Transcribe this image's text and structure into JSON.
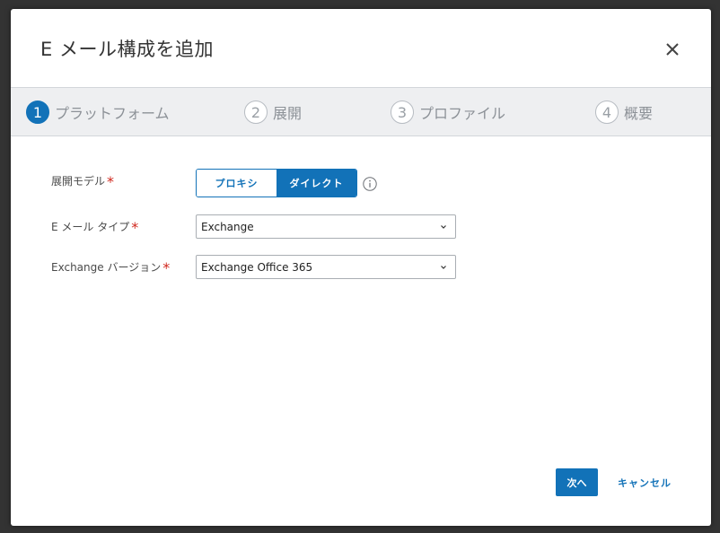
{
  "dialog": {
    "title": "E メール構成を追加"
  },
  "stepper": {
    "steps": [
      {
        "number": "1",
        "label": "プラットフォーム"
      },
      {
        "number": "2",
        "label": "展開"
      },
      {
        "number": "3",
        "label": "プロファイル"
      },
      {
        "number": "4",
        "label": "概要"
      }
    ]
  },
  "form": {
    "deployment_model": {
      "label": "展開モデル",
      "required_mark": "*",
      "options": [
        "プロキシ",
        "ダイレクト"
      ],
      "selected": "ダイレクト"
    },
    "email_type": {
      "label": "E メール タイプ",
      "required_mark": "*",
      "value": "Exchange"
    },
    "exchange_version": {
      "label": "Exchange バージョン",
      "required_mark": "*",
      "value": "Exchange Office 365"
    }
  },
  "footer": {
    "next_label": "次へ",
    "cancel_label": "キャンセル"
  },
  "colors": {
    "accent": "#1272b8",
    "required": "#d0271d",
    "stepper_bg": "#eeeff1"
  }
}
